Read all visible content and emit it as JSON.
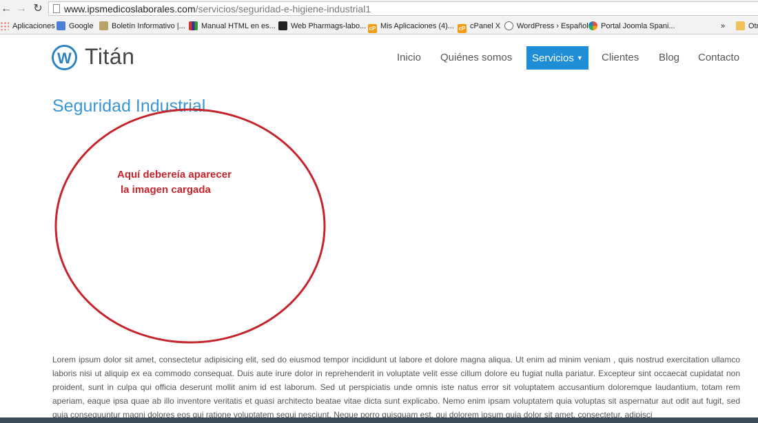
{
  "browser": {
    "url_host": "www.ipsmedicoslaborales.com",
    "url_path": "/servicios/seguridad-e-higiene-industrial1",
    "bookmarks": [
      {
        "label": "Aplicaciones",
        "icon": "apps-grid-icon"
      },
      {
        "label": "Google",
        "icon": "google-icon"
      },
      {
        "label": "Boletín Informativo |...",
        "icon": "newsletter-icon"
      },
      {
        "label": "Manual HTML en es...",
        "icon": "manual-icon"
      },
      {
        "label": "Web Pharmags-labo...",
        "icon": "pharma-icon"
      },
      {
        "label": "Mis Aplicaciones (4)...",
        "icon": "cpanel-icon"
      },
      {
        "label": "cPanel X",
        "icon": "cpanel-icon"
      },
      {
        "label": "WordPress › Español",
        "icon": "wordpress-icon"
      },
      {
        "label": "Portal Joomla Spani...",
        "icon": "joomla-icon"
      }
    ],
    "more_bookmarks": "»",
    "other_bookmarks": "Otr"
  },
  "site": {
    "logo_text": "Titán",
    "logo_mark": "W",
    "brand_color": "#2b84c0",
    "menu": [
      {
        "label": "Inicio"
      },
      {
        "label": "Quiénes somos"
      },
      {
        "label": "Servicios",
        "active": true
      },
      {
        "label": "Clientes"
      },
      {
        "label": "Blog"
      },
      {
        "label": "Contacto"
      }
    ]
  },
  "content": {
    "title": "Seguridad Industrial",
    "annotation_line1": "Aquí debereía aparecer",
    "annotation_line2": "la imagen cargada",
    "annotation_color": "#c5242b",
    "body": "Lorem ipsum dolor sit amet, consectetur adipisicing elit, sed do eiusmod tempor incididunt ut labore et dolore magna aliqua. Ut enim ad minim veniam , quis nostrud exercitation ullamco laboris nisi ut aliquip ex ea commodo consequat. Duis aute irure dolor in reprehenderit in voluptate velit esse cillum dolore eu fugiat nulla pariatur. Excepteur sint occaecat cupidatat non proident, sunt in culpa qui officia deserunt mollit anim id est laborum. Sed ut perspiciatis unde omnis iste natus error sit voluptatem accusantium doloremque laudantium, totam rem aperiam, eaque ipsa quae ab illo inventore veritatis et quasi architecto beatae vitae dicta sunt explicabo. Nemo enim ipsam voluptatem quia voluptas sit aspernatur aut odit aut fugit, sed quia consequuntur magni dolores eos qui ratione voluptatem sequi nesciunt. Neque porro quisquam est, qui dolorem ipsum quia dolor sit amet, consectetur, adipisci"
  }
}
